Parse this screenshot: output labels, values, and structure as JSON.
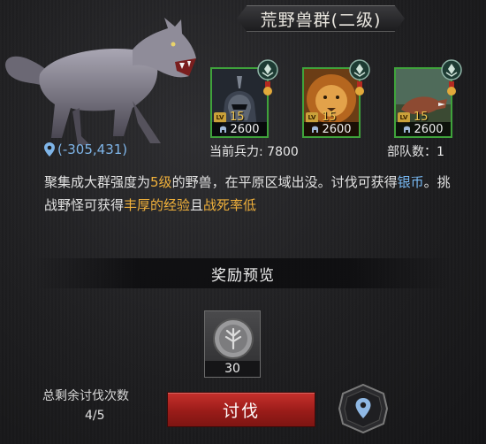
{
  "title": "荒野兽群(二级)",
  "coordinates": "(-305,431)",
  "units": [
    {
      "level": "15",
      "power": "2600",
      "icon": "dark-knight-portrait"
    },
    {
      "level": "15",
      "power": "2600",
      "icon": "lion-portrait"
    },
    {
      "level": "15",
      "power": "2600",
      "icon": "dinosaur-portrait"
    }
  ],
  "stats": {
    "power_label": "当前兵力: 7800",
    "troops_label": "部队数：1"
  },
  "description": {
    "p1": "聚集成大群强度为",
    "p2": "5级",
    "p3": "的野兽，在平原区域出没。讨伐可获得",
    "p4": "银币",
    "p5": "。挑战野怪可获得",
    "p6": "丰厚的经验",
    "p7": "且",
    "p8": "战死率低"
  },
  "reward": {
    "title": "奖励预览",
    "count": "30",
    "icon": "silver-coin"
  },
  "remaining": {
    "label": "总剩余讨伐次数",
    "value": "4/5"
  },
  "actions": {
    "attack_label": "讨伐",
    "locate_icon": "location-pin"
  },
  "colors": {
    "card_border": "#3fa33b",
    "highlight_orange": "#f1b13b",
    "highlight_blue": "#78b9f3",
    "button_red": "#b0231f"
  }
}
